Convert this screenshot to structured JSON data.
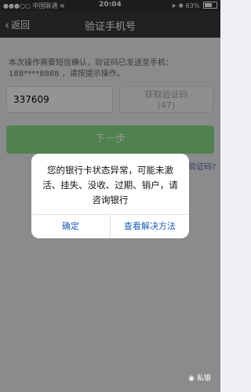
{
  "status_bar": {
    "carrier": "中国联通",
    "time": "20:04",
    "battery": "63%",
    "battery_level": 0.63
  },
  "nav": {
    "back_label": "返回",
    "title": "验证手机号"
  },
  "notice": {
    "line1": "本次操作需要短信确认，验证码已发送至手机：",
    "line2": "188****8888 ，请按提示操作。"
  },
  "code_input": {
    "value": "337609"
  },
  "resend_button": {
    "line1": "获取验证码",
    "line2": "(47)"
  },
  "next_button": {
    "label": "下一步"
  },
  "help_link": {
    "label": "验证码?"
  },
  "dialog": {
    "message": "您的银行卡状态异常，可能未激活、挂失、没收、过期、销户，请咨询银行",
    "confirm": "确定",
    "view_solution": "查看解决方法"
  },
  "watermark": {
    "text": "私银"
  }
}
